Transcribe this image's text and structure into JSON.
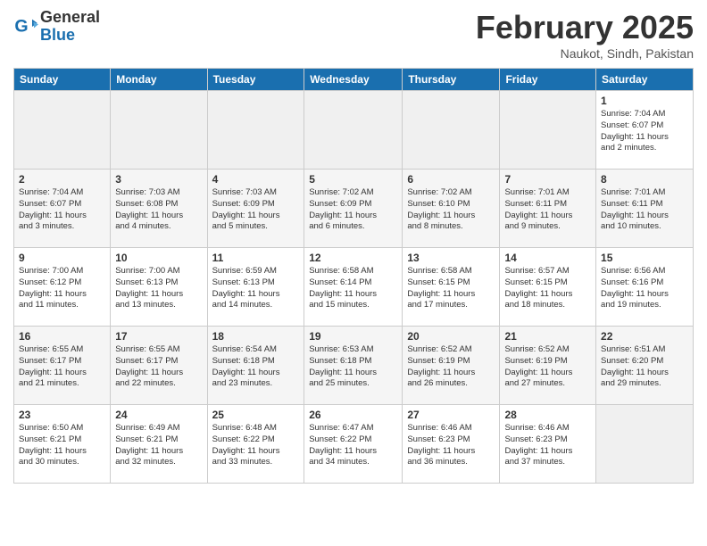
{
  "header": {
    "logo": {
      "line1": "General",
      "line2": "Blue"
    },
    "title": "February 2025",
    "location": "Naukot, Sindh, Pakistan"
  },
  "weekdays": [
    "Sunday",
    "Monday",
    "Tuesday",
    "Wednesday",
    "Thursday",
    "Friday",
    "Saturday"
  ],
  "weeks": [
    [
      {
        "day": "",
        "info": ""
      },
      {
        "day": "",
        "info": ""
      },
      {
        "day": "",
        "info": ""
      },
      {
        "day": "",
        "info": ""
      },
      {
        "day": "",
        "info": ""
      },
      {
        "day": "",
        "info": ""
      },
      {
        "day": "1",
        "info": "Sunrise: 7:04 AM\nSunset: 6:07 PM\nDaylight: 11 hours\nand 2 minutes."
      }
    ],
    [
      {
        "day": "2",
        "info": "Sunrise: 7:04 AM\nSunset: 6:07 PM\nDaylight: 11 hours\nand 3 minutes."
      },
      {
        "day": "3",
        "info": "Sunrise: 7:03 AM\nSunset: 6:08 PM\nDaylight: 11 hours\nand 4 minutes."
      },
      {
        "day": "4",
        "info": "Sunrise: 7:03 AM\nSunset: 6:09 PM\nDaylight: 11 hours\nand 5 minutes."
      },
      {
        "day": "5",
        "info": "Sunrise: 7:02 AM\nSunset: 6:09 PM\nDaylight: 11 hours\nand 6 minutes."
      },
      {
        "day": "6",
        "info": "Sunrise: 7:02 AM\nSunset: 6:10 PM\nDaylight: 11 hours\nand 8 minutes."
      },
      {
        "day": "7",
        "info": "Sunrise: 7:01 AM\nSunset: 6:11 PM\nDaylight: 11 hours\nand 9 minutes."
      },
      {
        "day": "8",
        "info": "Sunrise: 7:01 AM\nSunset: 6:11 PM\nDaylight: 11 hours\nand 10 minutes."
      }
    ],
    [
      {
        "day": "9",
        "info": "Sunrise: 7:00 AM\nSunset: 6:12 PM\nDaylight: 11 hours\nand 11 minutes."
      },
      {
        "day": "10",
        "info": "Sunrise: 7:00 AM\nSunset: 6:13 PM\nDaylight: 11 hours\nand 13 minutes."
      },
      {
        "day": "11",
        "info": "Sunrise: 6:59 AM\nSunset: 6:13 PM\nDaylight: 11 hours\nand 14 minutes."
      },
      {
        "day": "12",
        "info": "Sunrise: 6:58 AM\nSunset: 6:14 PM\nDaylight: 11 hours\nand 15 minutes."
      },
      {
        "day": "13",
        "info": "Sunrise: 6:58 AM\nSunset: 6:15 PM\nDaylight: 11 hours\nand 17 minutes."
      },
      {
        "day": "14",
        "info": "Sunrise: 6:57 AM\nSunset: 6:15 PM\nDaylight: 11 hours\nand 18 minutes."
      },
      {
        "day": "15",
        "info": "Sunrise: 6:56 AM\nSunset: 6:16 PM\nDaylight: 11 hours\nand 19 minutes."
      }
    ],
    [
      {
        "day": "16",
        "info": "Sunrise: 6:55 AM\nSunset: 6:17 PM\nDaylight: 11 hours\nand 21 minutes."
      },
      {
        "day": "17",
        "info": "Sunrise: 6:55 AM\nSunset: 6:17 PM\nDaylight: 11 hours\nand 22 minutes."
      },
      {
        "day": "18",
        "info": "Sunrise: 6:54 AM\nSunset: 6:18 PM\nDaylight: 11 hours\nand 23 minutes."
      },
      {
        "day": "19",
        "info": "Sunrise: 6:53 AM\nSunset: 6:18 PM\nDaylight: 11 hours\nand 25 minutes."
      },
      {
        "day": "20",
        "info": "Sunrise: 6:52 AM\nSunset: 6:19 PM\nDaylight: 11 hours\nand 26 minutes."
      },
      {
        "day": "21",
        "info": "Sunrise: 6:52 AM\nSunset: 6:19 PM\nDaylight: 11 hours\nand 27 minutes."
      },
      {
        "day": "22",
        "info": "Sunrise: 6:51 AM\nSunset: 6:20 PM\nDaylight: 11 hours\nand 29 minutes."
      }
    ],
    [
      {
        "day": "23",
        "info": "Sunrise: 6:50 AM\nSunset: 6:21 PM\nDaylight: 11 hours\nand 30 minutes."
      },
      {
        "day": "24",
        "info": "Sunrise: 6:49 AM\nSunset: 6:21 PM\nDaylight: 11 hours\nand 32 minutes."
      },
      {
        "day": "25",
        "info": "Sunrise: 6:48 AM\nSunset: 6:22 PM\nDaylight: 11 hours\nand 33 minutes."
      },
      {
        "day": "26",
        "info": "Sunrise: 6:47 AM\nSunset: 6:22 PM\nDaylight: 11 hours\nand 34 minutes."
      },
      {
        "day": "27",
        "info": "Sunrise: 6:46 AM\nSunset: 6:23 PM\nDaylight: 11 hours\nand 36 minutes."
      },
      {
        "day": "28",
        "info": "Sunrise: 6:46 AM\nSunset: 6:23 PM\nDaylight: 11 hours\nand 37 minutes."
      },
      {
        "day": "",
        "info": ""
      }
    ]
  ]
}
